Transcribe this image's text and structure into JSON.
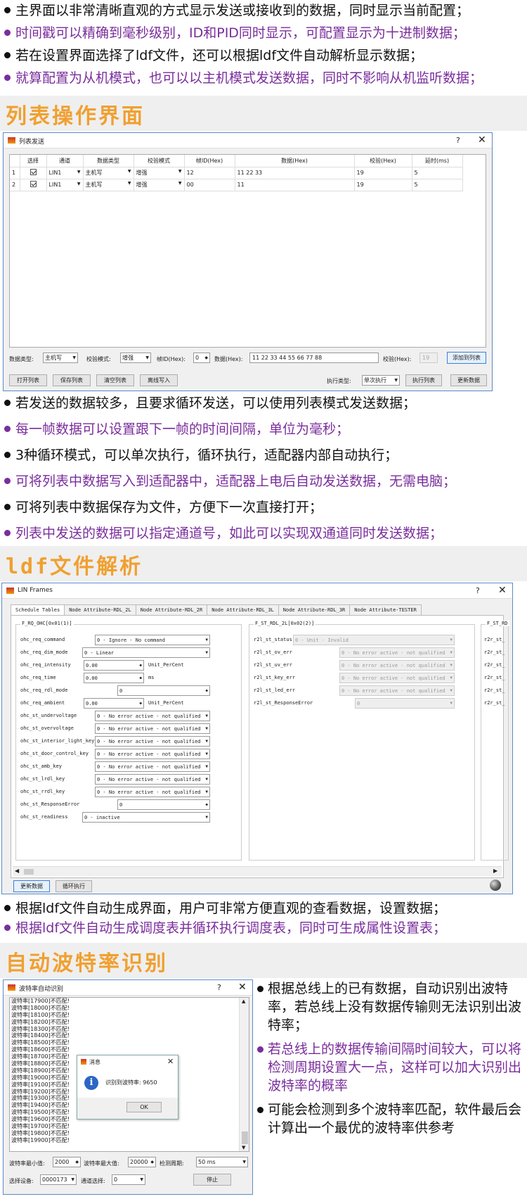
{
  "intro_bullets": [
    {
      "text": "主界面以非常清晰直观的方式显示发送或接收到的数据，同时显示当前配置；",
      "purple": false
    },
    {
      "text": "时间戳可以精确到毫秒级别，ID和PID同时显示，可配置显示为十进制数据；",
      "purple": true
    },
    {
      "text": "若在设置界面选择了ldf文件，还可以根据ldf文件自动解析显示数据；",
      "purple": false
    },
    {
      "text": "就算配置为从机模式，也可以以主机模式发送数据，同时不影响从机监听数据；",
      "purple": true
    }
  ],
  "section1": {
    "title": "列表操作界面"
  },
  "list_window": {
    "title": "列表发送",
    "help": "?",
    "close": "✕",
    "columns": [
      "选择",
      "通道",
      "数据类型",
      "校验模式",
      "帧ID(Hex)",
      "数据(Hex)",
      "校验(Hex)",
      "延时(ms)"
    ],
    "rows": [
      {
        "idx": "1",
        "checked": true,
        "channel": "LIN1",
        "type": "主机写",
        "check": "增强",
        "id": "12",
        "data": "11 22 33",
        "checksum": "19",
        "delay": "5"
      },
      {
        "idx": "2",
        "checked": true,
        "channel": "LIN1",
        "type": "主机写",
        "check": "增强",
        "id": "00",
        "data": "11",
        "checksum": "19",
        "delay": "5"
      }
    ],
    "form": {
      "type_label": "数据类型:",
      "type_value": "主机写",
      "check_label": "校验模式:",
      "check_value": "增强",
      "id_label": "帧ID(Hex):",
      "id_value": "0",
      "data_label": "数据(Hex):",
      "data_value": "11 22 33 44 55 66 77 88",
      "checksum_label": "校验(Hex):",
      "checksum_value": "19",
      "add_button": "添加到列表"
    },
    "buttons": {
      "open": "打开列表",
      "save": "保存列表",
      "clear": "清空列表",
      "offline": "离线写入",
      "exec_label": "执行类型:",
      "exec_value": "单次执行",
      "run": "执行列表",
      "update": "更新数据"
    }
  },
  "list_bullets": [
    {
      "text": "若发送的数据较多，且要求循环发送，可以使用列表模式发送数据；",
      "purple": false
    },
    {
      "text": "每一帧数据可以设置跟下一帧的时间间隔，单位为毫秒；",
      "purple": true
    },
    {
      "text": "3种循环模式，可以单次执行，循环执行，适配器内部自动执行；",
      "purple": false
    },
    {
      "text": "可将列表中数据写入到适配器中，适配器上电后自动发送数据，无需电脑；",
      "purple": true
    },
    {
      "text": "可将列表中数据保存为文件，方便下一次直接打开；",
      "purple": false
    },
    {
      "text": "列表中发送的数据可以指定通道号，如此可以实现双通道同时发送数据；",
      "purple": true
    }
  ],
  "section2": {
    "title": "ldf文件解析"
  },
  "lin_window": {
    "title": "LIN Frames",
    "help": "?",
    "close": "✕",
    "tabs": [
      "Schedule Tables",
      "Node Attribute-RDL_2L",
      "Node Attribute-RDL_2R",
      "Node Attribute-RDL_3L",
      "Node Attribute-RDL_3R",
      "Node Attribute-TESTER"
    ],
    "group1_title": "F_RQ_OHC[0x01(1)]",
    "group1_rows": [
      {
        "label": "ohc_req_command",
        "kind": "select",
        "value": "0 - Ignore - No command",
        "unit": ""
      },
      {
        "label": "ohc_req_dim_mode",
        "kind": "select",
        "value": "0 - Linear",
        "unit": ""
      },
      {
        "label": "ohc_req_intensity",
        "kind": "spin",
        "value": "0.00",
        "unit": "Unit_PerCent"
      },
      {
        "label": "ohc_req_time",
        "kind": "spin",
        "value": "0.00",
        "unit": "ms"
      },
      {
        "label": "ohc_req_rdl_mode",
        "kind": "spinwide",
        "value": "0",
        "unit": ""
      },
      {
        "label": "ohc_req_ambient",
        "kind": "spin",
        "value": "0.00",
        "unit": "Unit_PerCent"
      },
      {
        "label": "ohc_st_undervoltage",
        "kind": "select",
        "value": "0 - No error active - not qualified",
        "unit": ""
      },
      {
        "label": "ohc_st_overvoltage",
        "kind": "select",
        "value": "0 - No error active - not qualified",
        "unit": ""
      },
      {
        "label": "ohc_st_interior_light_key",
        "kind": "select",
        "value": "0 - No error active - not qualified",
        "unit": ""
      },
      {
        "label": "ohc_st_door_control_key",
        "kind": "select",
        "value": "0 - No error active - not qualified",
        "unit": ""
      },
      {
        "label": "ohc_st_amb_key",
        "kind": "select",
        "value": "0 - No error active - not qualified",
        "unit": ""
      },
      {
        "label": "ohc_st_lrdl_key",
        "kind": "select",
        "value": "0 - No error active - not qualified",
        "unit": ""
      },
      {
        "label": "ohc_st_rrdl_key",
        "kind": "select",
        "value": "0 - No error active - not qualified",
        "unit": ""
      },
      {
        "label": "ohc_st_ResponseError",
        "kind": "spinwide",
        "value": "0",
        "unit": ""
      },
      {
        "label": "ohc_st_readiness",
        "kind": "select",
        "value": "0 - inactive",
        "unit": ""
      }
    ],
    "group2_title": "F_ST_RDL_2L[0x02(2)]",
    "group2_rows": [
      {
        "label": "r2l_st_status",
        "value": "0 - Unit - Invalid"
      },
      {
        "label": "r2l_st_ov_err",
        "value": "0 - No error active - not qualified"
      },
      {
        "label": "r2l_st_uv_err",
        "value": "0 - No error active - not qualified"
      },
      {
        "label": "r2l_st_key_err",
        "value": "0 - No error active - not qualified"
      },
      {
        "label": "r2l_st_led_err",
        "value": "0 - No error active - not qualified"
      },
      {
        "label": "r2l_st_ResponseError",
        "value": "0"
      }
    ],
    "group3_title": "F_ST_RD",
    "group3_rows": [
      "r2r_st_",
      "r2r_st_",
      "r2r_st_",
      "r2r_st_",
      "r2r_st_",
      "r2r_st_"
    ],
    "buttons": {
      "update": "更新数据",
      "loop": "循环执行"
    }
  },
  "lin_bullets": [
    {
      "text": "根据ldf文件自动生成界面，用户可非常方便直观的查看数据，设置数据；",
      "purple": false
    },
    {
      "text": "根据ldf文件自动生成调度表并循环执行调度表，同时可生成属性设置表；",
      "purple": true
    }
  ],
  "section3": {
    "title": "自动波特率识别"
  },
  "baud_window": {
    "title": "波特率自动识别",
    "help": "?",
    "close": "✕",
    "log": [
      "波特率[17900]不匹配!",
      "波特率[18000]不匹配!",
      "波特率[18100]不匹配!",
      "波特率[18200]不匹配!",
      "波特率[18300]不匹配!",
      "波特率[18400]不匹配!",
      "波特率[18500]不匹配!",
      "波特率[18600]不匹配!",
      "波特率[18700]不匹配!",
      "波特率[18800]不匹配!",
      "波特率[18900]不匹配!",
      "波特率[19000]不匹配!",
      "波特率[19100]不匹配!",
      "波特率[19200]不匹配!",
      "波特率[19300]不匹配!",
      "波特率[19400]不匹配!",
      "波特率[19500]不匹配!",
      "波特率[19600]不匹配!",
      "波特率[19700]不匹配!",
      "波特率[19800]不匹配!",
      "波特率[19900]不匹配!"
    ],
    "dialog": {
      "title": "消息",
      "message": "识别到波特率: 9650",
      "ok": "OK",
      "close": "✕"
    },
    "form": {
      "min_label": "波特率最小值:",
      "min_value": "2000",
      "max_label": "波特率最大值:",
      "max_value": "20000",
      "period_label": "检测周期:",
      "period_value": "50 ms",
      "device_label": "选择设备:",
      "device_value": "0000173",
      "channel_label": "通道选择:",
      "channel_value": "0",
      "stop": "停止"
    }
  },
  "baud_bullets": [
    {
      "text": "根据总线上的已有数据，自动识别出波特率，若总线上没有数据传输则无法识别出波特率；",
      "purple": false
    },
    {
      "text": "若总线上的数据传输间隔时间较大，可以将检测周期设置大一点，这样可以加大识别出波特率的概率",
      "purple": true
    },
    {
      "text": "可能会检测到多个波特率匹配，软件最后会计算出一个最优的波特率供参考",
      "purple": false
    }
  ],
  "colors": {
    "purple": "#7a2d9c",
    "orange": "#f0a030",
    "window_border": "#5a8ac6"
  }
}
